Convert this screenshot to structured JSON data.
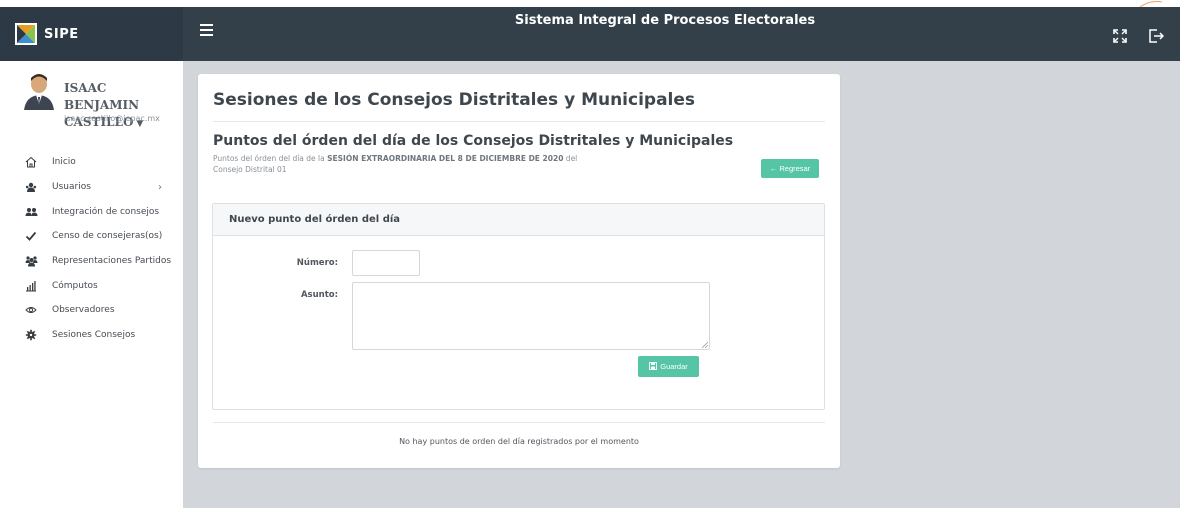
{
  "header": {
    "brand_name": "SIPE",
    "app_title": "Sistema Integral de Procesos Electorales",
    "icons": {
      "menu": "hamburger-icon",
      "expand": "expand-icon",
      "logout": "logout-icon"
    }
  },
  "user": {
    "name": "ISAAC BENJAMIN CASTILLO",
    "email": "isaac.castillo@iepac.mx"
  },
  "sidebar": {
    "items": [
      {
        "label": "Inicio",
        "icon": "home-icon"
      },
      {
        "label": "Usuarios",
        "icon": "users-icon",
        "has_submenu": true
      },
      {
        "label": "Integración de consejos",
        "icon": "group-icon"
      },
      {
        "label": "Censo de consejeras(os)",
        "icon": "check-icon"
      },
      {
        "label": "Representaciones Partidos",
        "icon": "people-icon"
      },
      {
        "label": "Cómputos",
        "icon": "bar-chart-icon"
      },
      {
        "label": "Observadores",
        "icon": "eye-icon"
      },
      {
        "label": "Sesiones Consejos",
        "icon": "gear-icon"
      }
    ]
  },
  "page": {
    "title": "Sesiones de los Consejos Distritales y Municipales",
    "subtitle": "Puntos del órden del día de los Consejos Distritales y Municipales",
    "desc_prefix": "Puntos del órden del día de la ",
    "desc_session": "SESIÓN EXTRAORDINARIA DEL 8 DE DICIEMBRE DE 2020",
    "desc_suffix": " del",
    "desc_council": "Consejo Distrital 01",
    "back_label": "← Regresar"
  },
  "form": {
    "panel_title": "Nuevo punto del órden del día",
    "numero_label": "Número:",
    "asunto_label": "Asunto:",
    "numero_value": "",
    "asunto_value": "",
    "save_label": "Guardar"
  },
  "empty_message": "No hay puntos de orden del día registrados por el momento",
  "colors": {
    "accent": "#56c5a6",
    "header": "#33404a",
    "background": "#d2d6da"
  }
}
